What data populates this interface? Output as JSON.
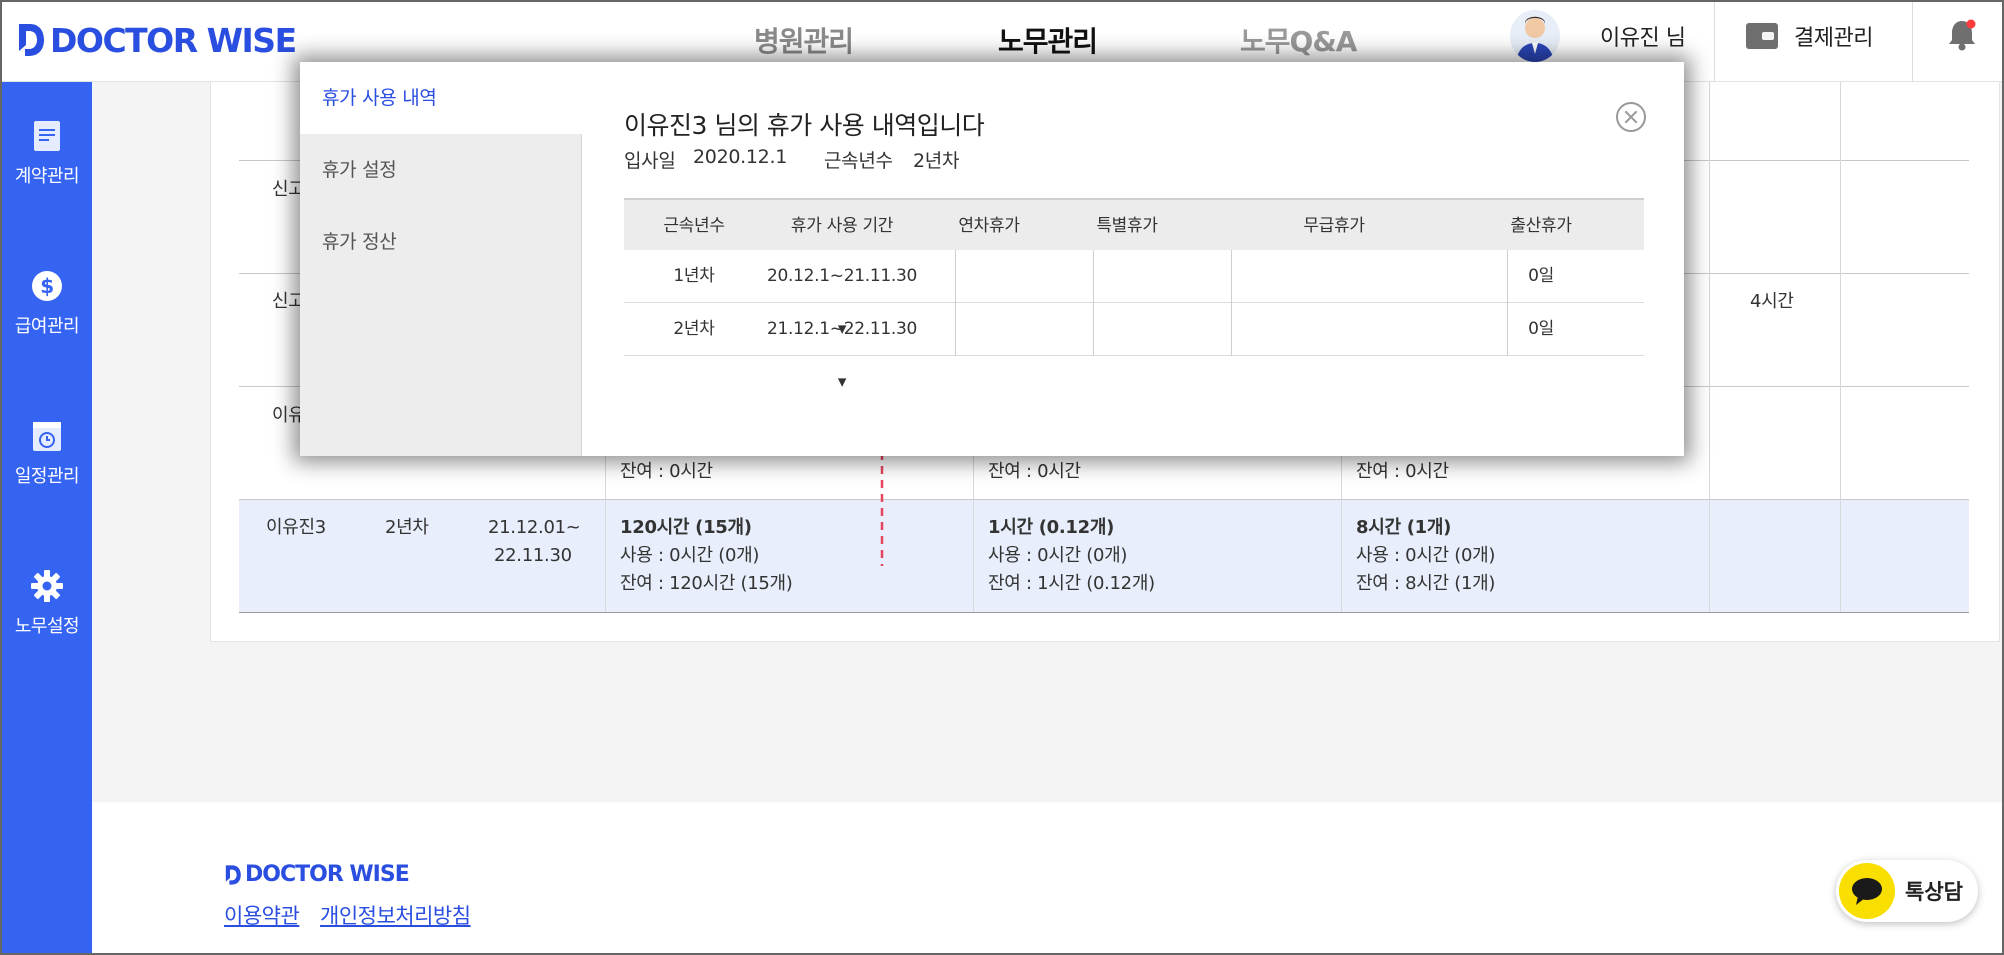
{
  "brand": {
    "name": "DOCTOR WISE"
  },
  "header": {
    "nav": [
      "병원관리",
      "노무관리",
      "노무Q&A"
    ],
    "user_name": "이유진 님",
    "payment_label": "결제관리"
  },
  "sidebar": {
    "items": [
      {
        "label": "계약관리",
        "icon": "contract-icon"
      },
      {
        "label": "급여관리",
        "icon": "salary-icon"
      },
      {
        "label": "일정관리",
        "icon": "schedule-icon"
      },
      {
        "label": "노무설정",
        "icon": "gear-icon"
      }
    ]
  },
  "background_table": {
    "row2_name": "신고",
    "row3_name": "신고",
    "row3_extra": "4시간",
    "row4_name": "이유",
    "row4_rest": [
      "잔여 : 0시간",
      "잔여 : 0시간",
      "잔여 : 0시간"
    ],
    "row5": {
      "name": "이유진3",
      "years": "2년차",
      "period_start": "21.12.01~",
      "period_end": "22.11.30",
      "annual": {
        "total": "120시간 (15개)",
        "used": "사용 : 0시간 (0개)",
        "rest": "잔여 : 120시간 (15개)"
      },
      "special": {
        "total": "1시간 (0.12개)",
        "used": "사용 : 0시간 (0개)",
        "rest": "잔여 : 1시간 (0.12개)"
      },
      "unpaid": {
        "total": "8시간 (1개)",
        "used": "사용 : 0시간 (0개)",
        "rest": "잔여 : 8시간 (1개)"
      }
    }
  },
  "modal": {
    "tabs": [
      "휴가 사용 내역",
      "휴가 설정",
      "휴가 정산"
    ],
    "title": "이유진3 님의 휴가 사용 내역입니다",
    "join_label": "입사일",
    "join_date": "2020.12.1",
    "tenure_label": "근속년수",
    "tenure_value": "2년차",
    "columns": [
      "근속년수",
      "휴가 사용 기간",
      "연차휴가",
      "특별휴가",
      "무급휴가",
      "출산휴가"
    ],
    "rows": [
      {
        "year": "1년차",
        "period": "20.12.1~21.11.30 ▾",
        "annual": "",
        "special": "",
        "unpaid": "",
        "maternity": "0일"
      },
      {
        "year": "2년차",
        "period": "21.12.1~22.11.30 ▾",
        "annual": "",
        "special": "",
        "unpaid": "",
        "maternity": "0일"
      }
    ]
  },
  "footer": {
    "links": [
      "이용약관",
      "개인정보처리방침"
    ],
    "chat_label": "톡상담"
  },
  "colors": {
    "accent": "#3564f3",
    "brand": "#2a4fe0",
    "highlight_row": "#e8eefb",
    "arrow": "#e8465e",
    "kakao": "#f9df00"
  }
}
